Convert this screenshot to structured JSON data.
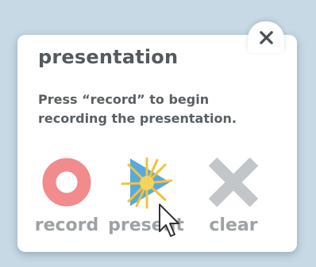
{
  "dialog": {
    "title": "presentation",
    "instruction": "Press “record” to begin recording the presentation."
  },
  "close_button": {
    "icon": "close-icon"
  },
  "actions": [
    {
      "id": "record",
      "label": "record",
      "icon": "record-icon",
      "color": "#f28b8b"
    },
    {
      "id": "present",
      "label": "present",
      "icon": "play-icon",
      "color": "#5aa9dc"
    },
    {
      "id": "clear",
      "label": "clear",
      "icon": "clear-x-icon",
      "color": "#c2c6c9"
    }
  ],
  "colors": {
    "background": "#c6d9e4",
    "panel": "#ffffff",
    "title_text": "#555a5e",
    "label_text": "#9ea2a5",
    "click_burst": "#f2c23b"
  }
}
